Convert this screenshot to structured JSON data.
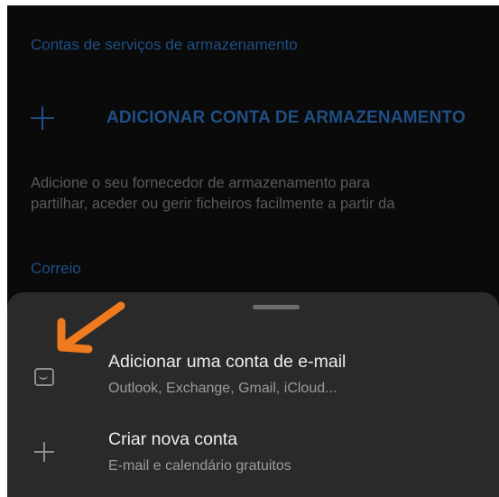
{
  "settings": {
    "storage_section_title": "Contas de serviços de armazenamento",
    "add_storage_label": "ADICIONAR CONTA DE ARMAZENAMENTO",
    "storage_description_line1": "Adicione o seu fornecedor de armazenamento para",
    "storage_description_line2": "partilhar, aceder ou gerir ficheiros facilmente a partir da",
    "mail_section_title": "Correio"
  },
  "sheet": {
    "options": [
      {
        "icon": "inbox-icon",
        "title": "Adicionar uma conta de e-mail",
        "subtitle": "Outlook, Exchange, Gmail, iCloud..."
      },
      {
        "icon": "plus-icon",
        "title": "Criar nova conta",
        "subtitle": "E-mail e calendário gratuitos"
      }
    ]
  },
  "colors": {
    "accent": "#1f4f86",
    "sheet_background": "#2a2a2a",
    "annotation_arrow": "#f07a1e"
  }
}
